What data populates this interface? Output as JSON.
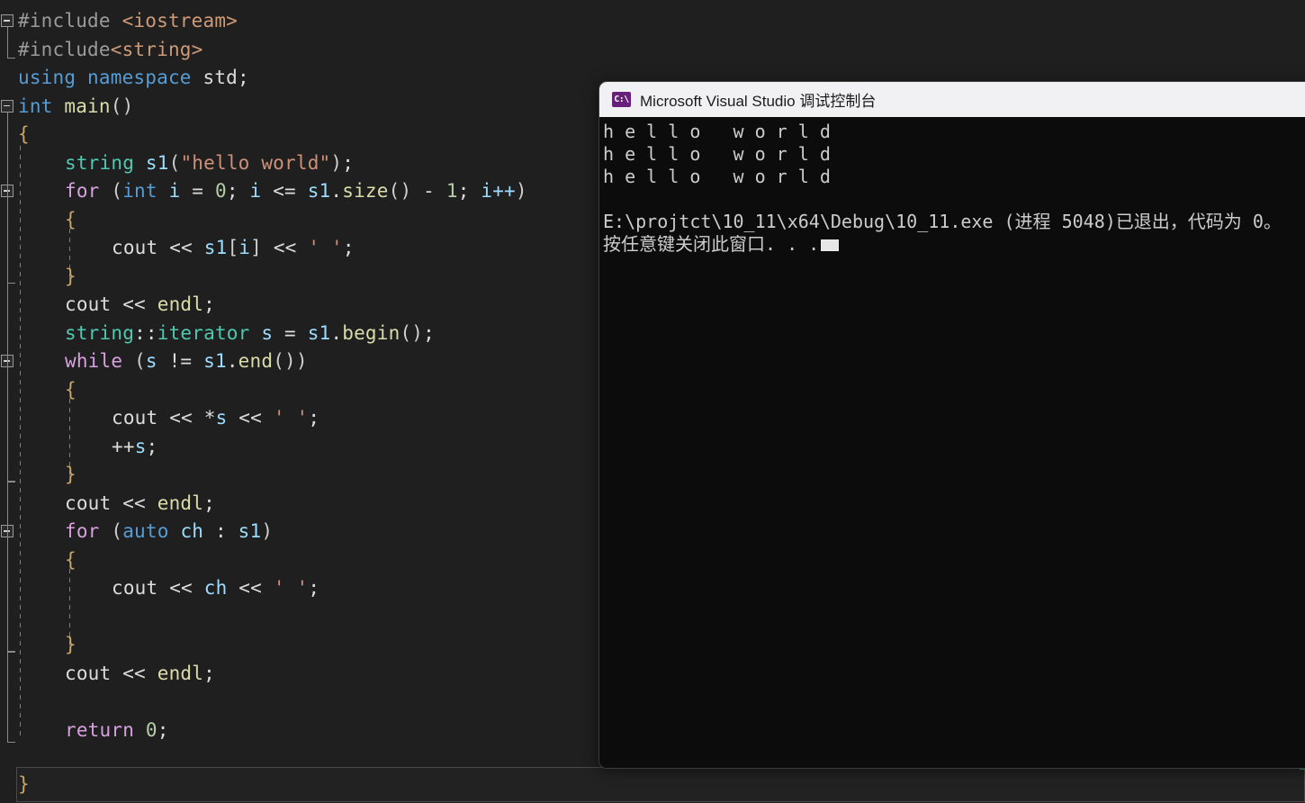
{
  "editor": {
    "name": "visual-studio-code-editor",
    "theme": "dark",
    "background": "#1f1f1f",
    "colors": {
      "preprocessor": "#9b9b9b",
      "include_header": "#cd9a78",
      "keyword": "#569cd6",
      "control_keyword": "#d8a0df",
      "type": "#4ec9b0",
      "variable": "#9cdcfe",
      "function": "#dcdcaa",
      "string": "#ce9178",
      "number": "#b5cea8",
      "plain": "#dcdcdc",
      "brace": "#c8a56a"
    },
    "lines": [
      {
        "indent": 0,
        "fold": "start",
        "tokens": [
          {
            "t": "#include ",
            "c": "t-pp"
          },
          {
            "t": "<iostream>",
            "c": "t-ppinc"
          }
        ]
      },
      {
        "indent": 0,
        "fold": "end",
        "tokens": [
          {
            "t": "#include",
            "c": "t-pp"
          },
          {
            "t": "<string>",
            "c": "t-ppinc"
          }
        ]
      },
      {
        "indent": 0,
        "fold": "none",
        "tokens": [
          {
            "t": "using namespace ",
            "c": "t-kw"
          },
          {
            "t": "std;",
            "c": "t-plain"
          }
        ]
      },
      {
        "indent": 0,
        "fold": "start",
        "tokens": [
          {
            "t": "int ",
            "c": "t-kw"
          },
          {
            "t": "main",
            "c": "t-fn"
          },
          {
            "t": "()",
            "c": "t-paren"
          }
        ]
      },
      {
        "indent": 0,
        "fold": "rail",
        "tokens": [
          {
            "t": "{",
            "c": "t-brace"
          }
        ]
      },
      {
        "indent": 1,
        "fold": "rail",
        "tokens": [
          {
            "t": "string ",
            "c": "t-type"
          },
          {
            "t": "s1",
            "c": "t-var"
          },
          {
            "t": "(",
            "c": "t-paren"
          },
          {
            "t": "\"hello world\"",
            "c": "t-str"
          },
          {
            "t": ")",
            "c": "t-paren"
          },
          {
            "t": ";",
            "c": "t-plain"
          }
        ]
      },
      {
        "indent": 1,
        "fold": "start",
        "tokens": [
          {
            "t": "for ",
            "c": "t-ctrl"
          },
          {
            "t": "(",
            "c": "t-paren"
          },
          {
            "t": "int ",
            "c": "t-kw"
          },
          {
            "t": "i ",
            "c": "t-var"
          },
          {
            "t": "= ",
            "c": "t-plain"
          },
          {
            "t": "0",
            "c": "t-num"
          },
          {
            "t": "; ",
            "c": "t-plain"
          },
          {
            "t": "i ",
            "c": "t-var"
          },
          {
            "t": "<= ",
            "c": "t-plain"
          },
          {
            "t": "s1",
            "c": "t-var"
          },
          {
            "t": ".",
            "c": "t-plain"
          },
          {
            "t": "size",
            "c": "t-fn"
          },
          {
            "t": "()",
            "c": "t-paren"
          },
          {
            "t": " - ",
            "c": "t-plain"
          },
          {
            "t": "1",
            "c": "t-num"
          },
          {
            "t": "; ",
            "c": "t-plain"
          },
          {
            "t": "i++",
            "c": "t-var"
          },
          {
            "t": ")",
            "c": "t-paren"
          }
        ]
      },
      {
        "indent": 1,
        "fold": "rail",
        "tokens": [
          {
            "t": "{",
            "c": "t-brace"
          }
        ]
      },
      {
        "indent": 2,
        "fold": "rail",
        "tokens": [
          {
            "t": "cout ",
            "c": "t-plain"
          },
          {
            "t": "<< ",
            "c": "t-plain"
          },
          {
            "t": "s1",
            "c": "t-var"
          },
          {
            "t": "[",
            "c": "t-paren"
          },
          {
            "t": "i",
            "c": "t-var"
          },
          {
            "t": "] ",
            "c": "t-paren"
          },
          {
            "t": "<< ",
            "c": "t-plain"
          },
          {
            "t": "' '",
            "c": "t-str"
          },
          {
            "t": ";",
            "c": "t-plain"
          }
        ]
      },
      {
        "indent": 1,
        "fold": "rail",
        "tokens": [
          {
            "t": "}",
            "c": "t-brace"
          }
        ]
      },
      {
        "indent": 1,
        "fold": "foot",
        "tokens": [
          {
            "t": "cout ",
            "c": "t-plain"
          },
          {
            "t": "<< ",
            "c": "t-plain"
          },
          {
            "t": "endl",
            "c": "t-fn"
          },
          {
            "t": ";",
            "c": "t-plain"
          }
        ]
      },
      {
        "indent": 1,
        "fold": "rail",
        "tokens": [
          {
            "t": "string",
            "c": "t-type"
          },
          {
            "t": "::",
            "c": "t-plain"
          },
          {
            "t": "iterator ",
            "c": "t-type"
          },
          {
            "t": "s ",
            "c": "t-var"
          },
          {
            "t": "= ",
            "c": "t-plain"
          },
          {
            "t": "s1",
            "c": "t-var"
          },
          {
            "t": ".",
            "c": "t-plain"
          },
          {
            "t": "begin",
            "c": "t-fn"
          },
          {
            "t": "()",
            "c": "t-paren"
          },
          {
            "t": ";",
            "c": "t-plain"
          }
        ]
      },
      {
        "indent": 1,
        "fold": "start",
        "tokens": [
          {
            "t": "while ",
            "c": "t-ctrl"
          },
          {
            "t": "(",
            "c": "t-paren"
          },
          {
            "t": "s ",
            "c": "t-var"
          },
          {
            "t": "!= ",
            "c": "t-plain"
          },
          {
            "t": "s1",
            "c": "t-var"
          },
          {
            "t": ".",
            "c": "t-plain"
          },
          {
            "t": "end",
            "c": "t-fn"
          },
          {
            "t": "())",
            "c": "t-paren"
          }
        ]
      },
      {
        "indent": 1,
        "fold": "rail",
        "tokens": [
          {
            "t": "{",
            "c": "t-brace"
          }
        ]
      },
      {
        "indent": 2,
        "fold": "rail",
        "tokens": [
          {
            "t": "cout ",
            "c": "t-plain"
          },
          {
            "t": "<< ",
            "c": "t-plain"
          },
          {
            "t": "*",
            "c": "t-plain"
          },
          {
            "t": "s ",
            "c": "t-var"
          },
          {
            "t": "<< ",
            "c": "t-plain"
          },
          {
            "t": "' '",
            "c": "t-str"
          },
          {
            "t": ";",
            "c": "t-plain"
          }
        ]
      },
      {
        "indent": 2,
        "fold": "rail",
        "tokens": [
          {
            "t": "++",
            "c": "t-plain"
          },
          {
            "t": "s",
            "c": "t-var"
          },
          {
            "t": ";",
            "c": "t-plain"
          }
        ]
      },
      {
        "indent": 1,
        "fold": "rail",
        "tokens": [
          {
            "t": "}",
            "c": "t-brace"
          }
        ]
      },
      {
        "indent": 1,
        "fold": "foot",
        "tokens": [
          {
            "t": "cout ",
            "c": "t-plain"
          },
          {
            "t": "<< ",
            "c": "t-plain"
          },
          {
            "t": "endl",
            "c": "t-fn"
          },
          {
            "t": ";",
            "c": "t-plain"
          }
        ]
      },
      {
        "indent": 1,
        "fold": "start",
        "tokens": [
          {
            "t": "for ",
            "c": "t-ctrl"
          },
          {
            "t": "(",
            "c": "t-paren"
          },
          {
            "t": "auto ",
            "c": "t-kw"
          },
          {
            "t": "ch ",
            "c": "t-var"
          },
          {
            "t": ": ",
            "c": "t-plain"
          },
          {
            "t": "s1",
            "c": "t-var"
          },
          {
            "t": ")",
            "c": "t-paren"
          }
        ]
      },
      {
        "indent": 1,
        "fold": "rail",
        "tokens": [
          {
            "t": "{",
            "c": "t-brace"
          }
        ]
      },
      {
        "indent": 2,
        "fold": "rail",
        "tokens": [
          {
            "t": "cout ",
            "c": "t-plain"
          },
          {
            "t": "<< ",
            "c": "t-plain"
          },
          {
            "t": "ch ",
            "c": "t-var"
          },
          {
            "t": "<< ",
            "c": "t-plain"
          },
          {
            "t": "' '",
            "c": "t-str"
          },
          {
            "t": ";",
            "c": "t-plain"
          }
        ]
      },
      {
        "indent": 2,
        "fold": "rail",
        "tokens": []
      },
      {
        "indent": 1,
        "fold": "rail",
        "tokens": [
          {
            "t": "}",
            "c": "t-brace"
          }
        ]
      },
      {
        "indent": 1,
        "fold": "foot",
        "tokens": [
          {
            "t": "cout ",
            "c": "t-plain"
          },
          {
            "t": "<< ",
            "c": "t-plain"
          },
          {
            "t": "endl",
            "c": "t-fn"
          },
          {
            "t": ";",
            "c": "t-plain"
          }
        ]
      },
      {
        "indent": 1,
        "fold": "rail",
        "tokens": []
      },
      {
        "indent": 1,
        "fold": "rail",
        "tokens": [
          {
            "t": "return ",
            "c": "t-ctrl"
          },
          {
            "t": "0",
            "c": "t-num"
          },
          {
            "t": ";",
            "c": "t-plain"
          }
        ]
      }
    ],
    "current_line": {
      "text": "}",
      "color": "#c8a56a"
    },
    "change_marker_color": "#4a9e5c"
  },
  "console": {
    "name": "debug-console-window",
    "title": "Microsoft Visual Studio 调试控制台",
    "icon": "console-icon",
    "icon_label": "C:\\",
    "icon_color": "#68217a",
    "titlebar_background": "#f1f1f4",
    "background": "#0c0c0c",
    "foreground": "#cccccc",
    "output": [
      "h e l l o   w o r l d ",
      "h e l l o   w o r l d ",
      "h e l l o   w o r l d ",
      "",
      "E:\\projtct\\10_11\\x64\\Debug\\10_11.exe (进程 5048)已退出，代码为 0。"
    ],
    "prompt_line": "按任意键关闭此窗口. . .",
    "cursor": "block-cursor"
  }
}
